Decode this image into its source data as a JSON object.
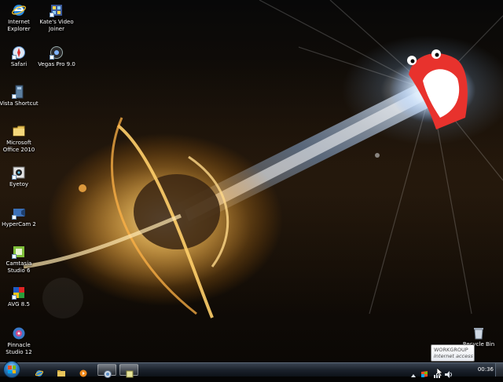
{
  "desktop": {
    "icons": [
      {
        "label": "Internet\nExplorer",
        "icon": "internet-explorer-icon"
      },
      {
        "label": "Kate's Video\nJoiner",
        "icon": "video-joiner-icon"
      },
      {
        "label": "Safari",
        "icon": "safari-icon"
      },
      {
        "label": "Vegas Pro 9.0",
        "icon": "vegas-pro-icon"
      },
      {
        "label": "Vista Shortcut",
        "icon": "vista-shortcut-icon"
      },
      {
        "label": "Microsoft\nOffice 2010",
        "icon": "folder-icon"
      },
      {
        "label": "Eyetoy",
        "icon": "eyetoy-icon"
      },
      {
        "label": "HyperCam 2",
        "icon": "hypercam-icon"
      },
      {
        "label": "Camtasia\nStudio 6",
        "icon": "camtasia-icon"
      },
      {
        "label": "AVG 8.5",
        "icon": "avg-icon"
      },
      {
        "label": "Pinnacle\nStudio 12",
        "icon": "pinnacle-icon"
      },
      {
        "label": "Recycle Bin",
        "icon": "recycle-bin-icon"
      }
    ]
  },
  "taskbar": {
    "start": "start-orb",
    "pinned": [
      "internet-explorer-icon",
      "explorer-folder-icon",
      "media-player-icon",
      "browser-window-icon",
      "notes-window-icon"
    ],
    "tray": {
      "icons": [
        "show-hidden-icons",
        "action-center-icon",
        "network-icon",
        "volume-icon"
      ],
      "clock": "00:36"
    }
  },
  "tooltip": {
    "title": "WORKGROUP",
    "subtitle": "Internet access"
  },
  "colors": {
    "taskbar": "#1b222c",
    "mascot_red": "#e8322d",
    "beam": "#cfe6ff"
  }
}
